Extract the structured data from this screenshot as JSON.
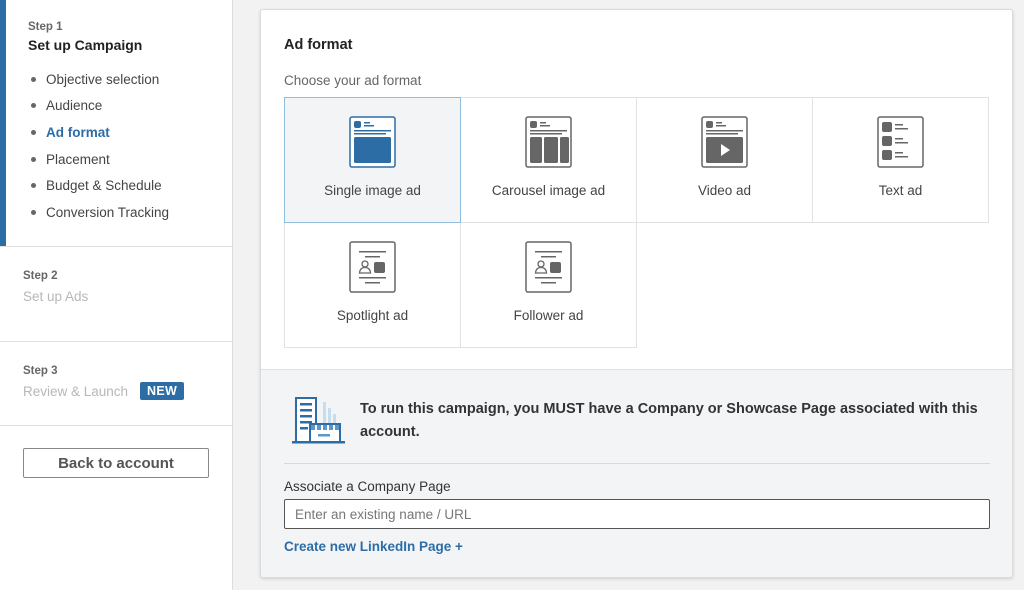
{
  "sidebar": {
    "step1": {
      "label": "Step 1",
      "title": "Set up Campaign",
      "items": [
        {
          "label": "Objective selection",
          "active": false
        },
        {
          "label": "Audience",
          "active": false
        },
        {
          "label": "Ad format",
          "active": true
        },
        {
          "label": "Placement",
          "active": false
        },
        {
          "label": "Budget & Schedule",
          "active": false
        },
        {
          "label": "Conversion Tracking",
          "active": false
        }
      ]
    },
    "step2": {
      "label": "Step 2",
      "title": "Set up Ads"
    },
    "step3": {
      "label": "Step 3",
      "title": "Review & Launch",
      "badge": "NEW"
    },
    "back_button": "Back to account",
    "accent_color": "#2d6da6"
  },
  "main": {
    "title": "Ad format",
    "subtitle": "Choose your ad format",
    "formats": [
      {
        "label": "Single image ad",
        "icon": "single-image-ad-icon",
        "selected": true
      },
      {
        "label": "Carousel image ad",
        "icon": "carousel-image-ad-icon",
        "selected": false
      },
      {
        "label": "Video ad",
        "icon": "video-ad-icon",
        "selected": false
      },
      {
        "label": "Text ad",
        "icon": "text-ad-icon",
        "selected": false
      },
      {
        "label": "Spotlight ad",
        "icon": "spotlight-ad-icon",
        "selected": false
      },
      {
        "label": "Follower ad",
        "icon": "follower-ad-icon",
        "selected": false
      }
    ],
    "notice": {
      "icon": "building-icon",
      "message": "To run this campaign, you MUST have a Company or Showcase Page associated with this account.",
      "field_label": "Associate a Company Page",
      "input_value": "",
      "input_placeholder": "Enter an existing name / URL",
      "create_link": "Create new LinkedIn Page +"
    }
  }
}
